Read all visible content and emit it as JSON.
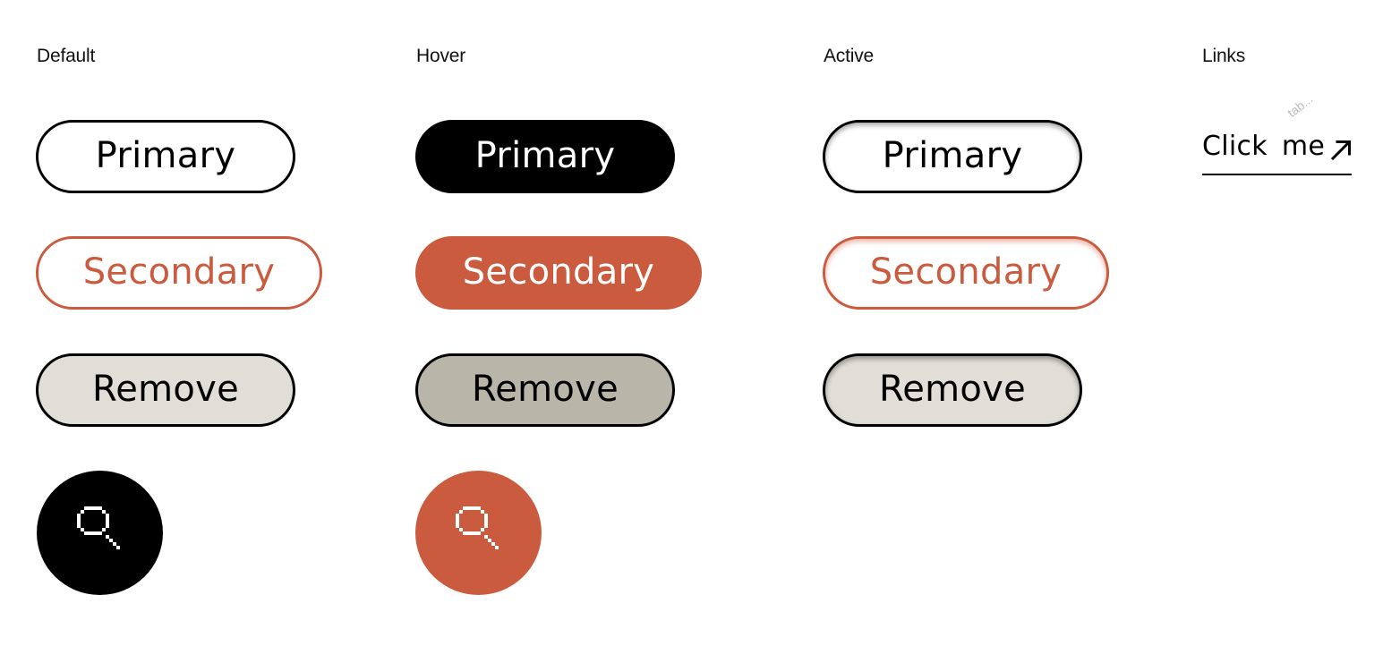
{
  "columns": {
    "default": "Default",
    "hover": "Hover",
    "active": "Active",
    "links": "Links"
  },
  "buttons": {
    "primary": "Primary",
    "secondary": "Secondary",
    "remove": "Remove"
  },
  "icons": {
    "search": "search-icon",
    "arrow": "arrow-up-right-icon"
  },
  "link": {
    "label": "Click me",
    "hint": "tab..."
  },
  "colors": {
    "black": "#000000",
    "accent": "#cb5b3f",
    "neutral": "#e1ded7",
    "neutral_hover": "#b9b5a9"
  }
}
